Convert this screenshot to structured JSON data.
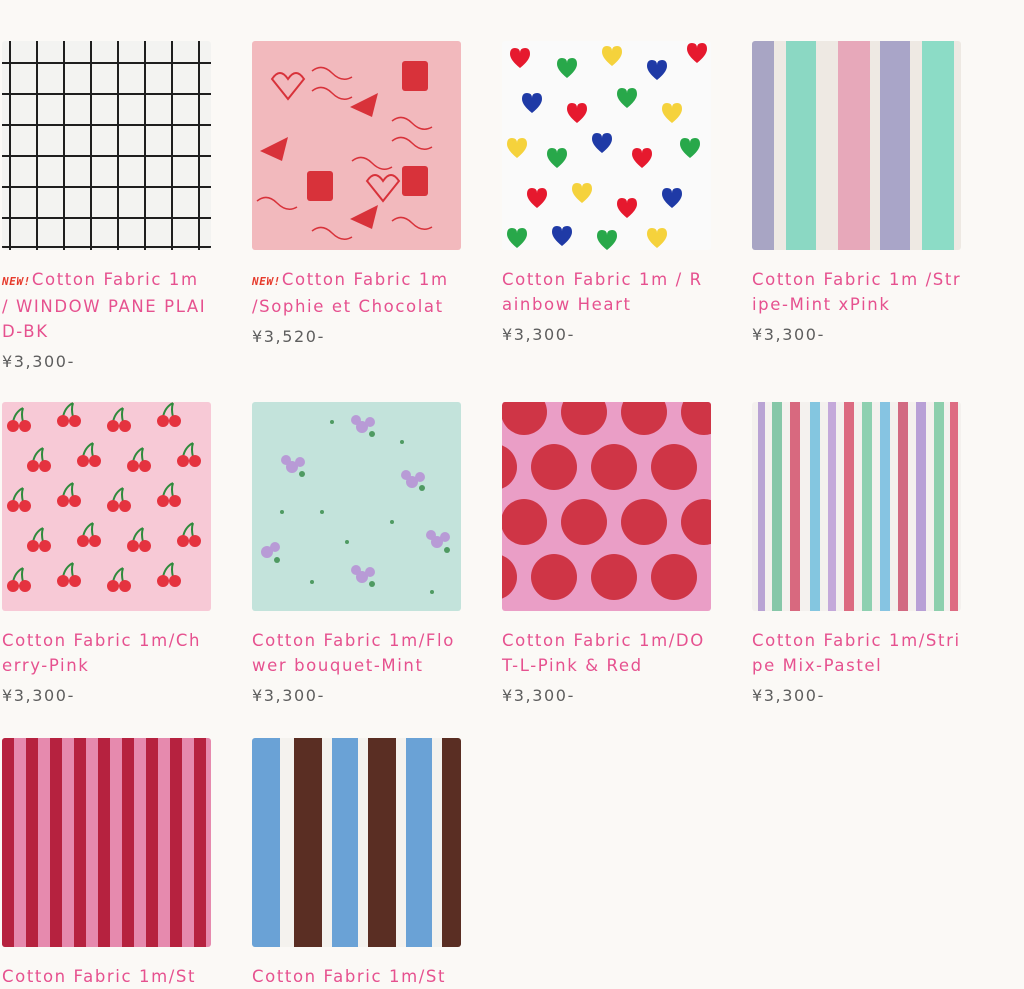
{
  "new_badge": "NEW!",
  "products": [
    {
      "title": "Cotton Fabric 1m / WINDOW PANE PLAID-BK",
      "price": "¥3,300-",
      "is_new": true,
      "pattern": "grid-black-on-white"
    },
    {
      "title": "Cotton Fabric 1m /Sophie et Chocolat",
      "price": "¥3,520-",
      "is_new": true,
      "pattern": "sophie-et-chocolat-pink"
    },
    {
      "title": "Cotton Fabric 1m / Rainbow Heart",
      "price": "¥3,300-",
      "is_new": false,
      "pattern": "rainbow-hearts"
    },
    {
      "title": "Cotton Fabric 1m /Stripe-Mint xPink",
      "price": "¥3,300-",
      "is_new": false,
      "pattern": "stripe-mint-pink"
    },
    {
      "title": "Cotton Fabric 1m/Cherry-Pink",
      "price": "¥3,300-",
      "is_new": false,
      "pattern": "cherry-pink"
    },
    {
      "title": "Cotton Fabric 1m/Flower bouquet-Mint",
      "price": "¥3,300-",
      "is_new": false,
      "pattern": "flower-bouquet-mint"
    },
    {
      "title": "Cotton Fabric 1m/DOT-L-Pink & Red",
      "price": "¥3,300-",
      "is_new": false,
      "pattern": "dot-pink-red"
    },
    {
      "title": "Cotton Fabric 1m/Stripe Mix-Pastel",
      "price": "¥3,300-",
      "is_new": false,
      "pattern": "stripe-mix-pastel"
    },
    {
      "title": "Cotton Fabric 1m/St",
      "price": "",
      "is_new": false,
      "pattern": "stripe-red-pink"
    },
    {
      "title": "Cotton Fabric 1m/St",
      "price": "",
      "is_new": false,
      "pattern": "stripe-blue-brown"
    }
  ],
  "colors": {
    "title": "#e6518f",
    "price": "#5e5e5e",
    "new_badge": "#e63b2c",
    "background": "#fbf9f6"
  }
}
